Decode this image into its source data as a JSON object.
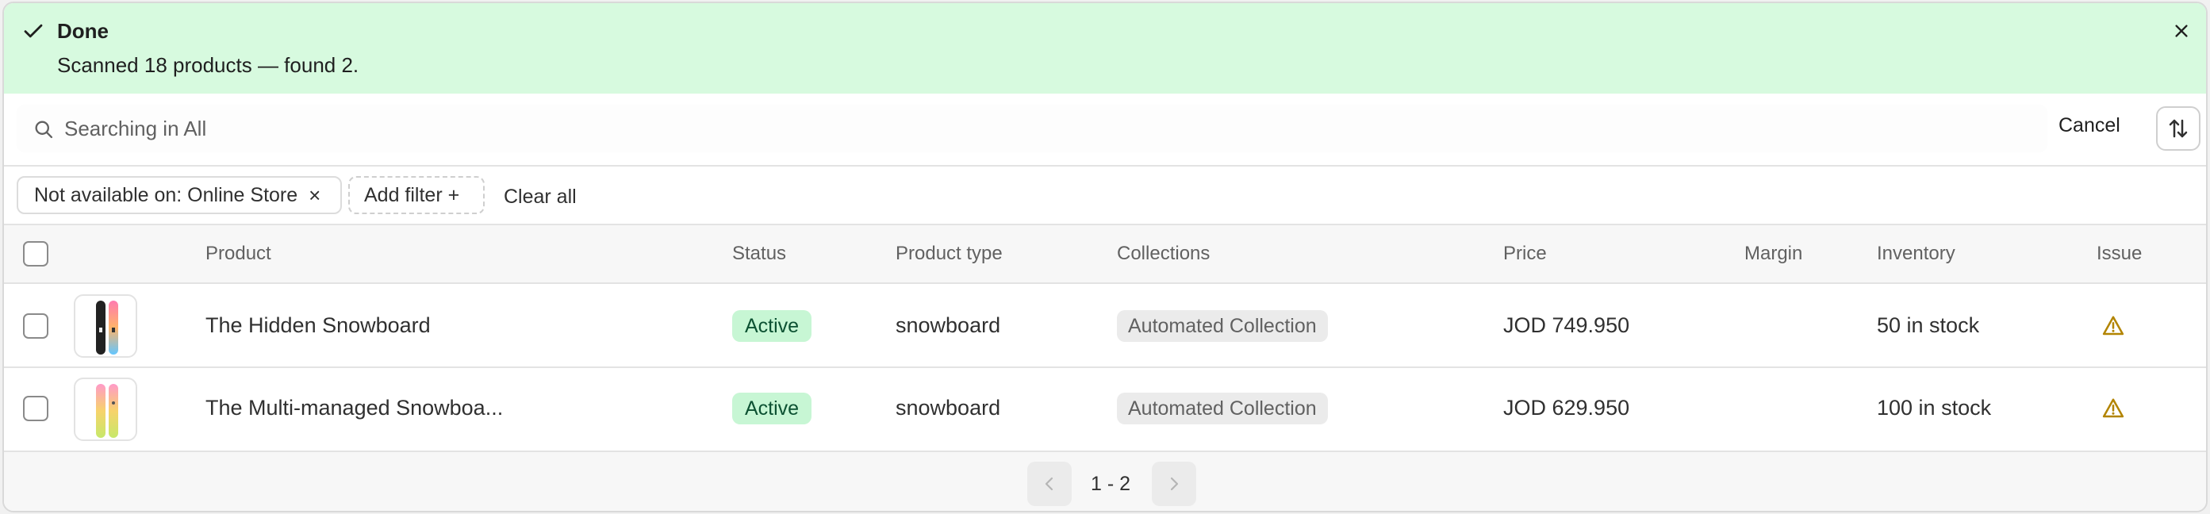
{
  "banner": {
    "title": "Done",
    "message": "Scanned 18 products — found 2.",
    "bg_color": "#d7fadf"
  },
  "search": {
    "placeholder": "Searching in All",
    "cancel_label": "Cancel"
  },
  "filters": {
    "active_filter": "Not available on: Online Store",
    "remove_symbol": "×",
    "add_filter_label": "Add filter +",
    "clear_all_label": "Clear all"
  },
  "table": {
    "columns": [
      "Product",
      "Status",
      "Product type",
      "Collections",
      "Price",
      "Margin",
      "Inventory",
      "Issue"
    ],
    "rows": [
      {
        "product": "The Hidden Snowboard",
        "status": "Active",
        "product_type": "snowboard",
        "collection": "Automated Collection",
        "price": "JOD 749.950",
        "margin": "",
        "inventory": "50 in stock",
        "issue_icon": "warning-icon"
      },
      {
        "product": "The Multi-managed Snowboa...",
        "status": "Active",
        "product_type": "snowboard",
        "collection": "Automated Collection",
        "price": "JOD 629.950",
        "margin": "",
        "inventory": "100 in stock",
        "issue_icon": "warning-icon"
      }
    ]
  },
  "pagination": {
    "label": "1 - 2"
  },
  "colors": {
    "active_badge_bg": "#c7f6d4",
    "active_badge_text": "#0c5132",
    "warning": "#b28400"
  }
}
